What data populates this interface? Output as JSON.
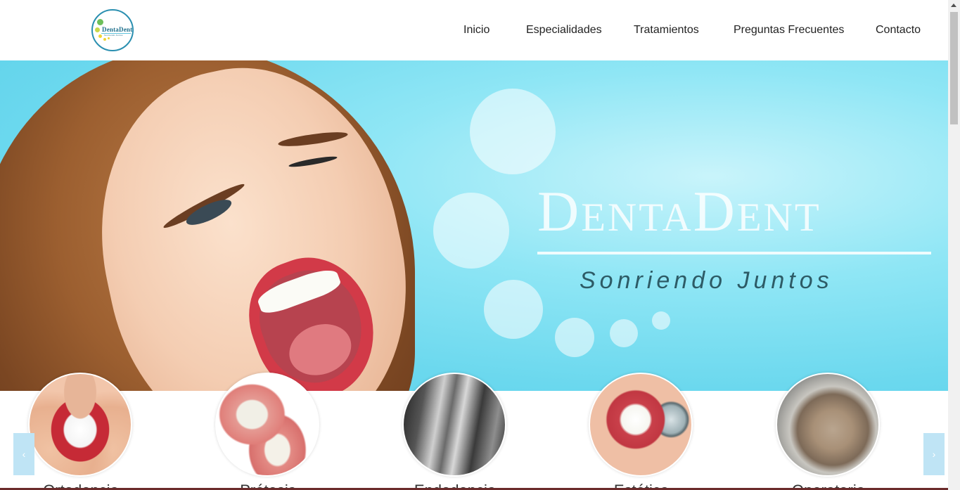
{
  "header": {
    "logo_text": "DentaDent",
    "logo_subtext": "Sonriendo Juntos",
    "nav": [
      {
        "label": "Inicio"
      },
      {
        "label": "Especialidades"
      },
      {
        "label": "Tratamientos"
      },
      {
        "label": "Preguntas Frecuentes"
      },
      {
        "label": "Contacto"
      }
    ]
  },
  "hero": {
    "brand": "DentaDent",
    "tagline": "Sonriendo Juntos"
  },
  "carousel": {
    "prev_label": "‹",
    "next_label": "›",
    "items": [
      {
        "label": "Ortodoncia",
        "image": "aligner-photo"
      },
      {
        "label": "Prótesis",
        "image": "denture-photo"
      },
      {
        "label": "Endodoncia",
        "image": "xray-photo"
      },
      {
        "label": "Estética",
        "image": "smile-mirror-photo"
      },
      {
        "label": "Operatoria",
        "image": "molar-filling-photo"
      }
    ]
  },
  "colors": {
    "accent": "#2a8fb0",
    "hero_bg": "#6bd8ee",
    "arrow_bg": "#bfe4f5",
    "tagline": "#2d5b66"
  }
}
